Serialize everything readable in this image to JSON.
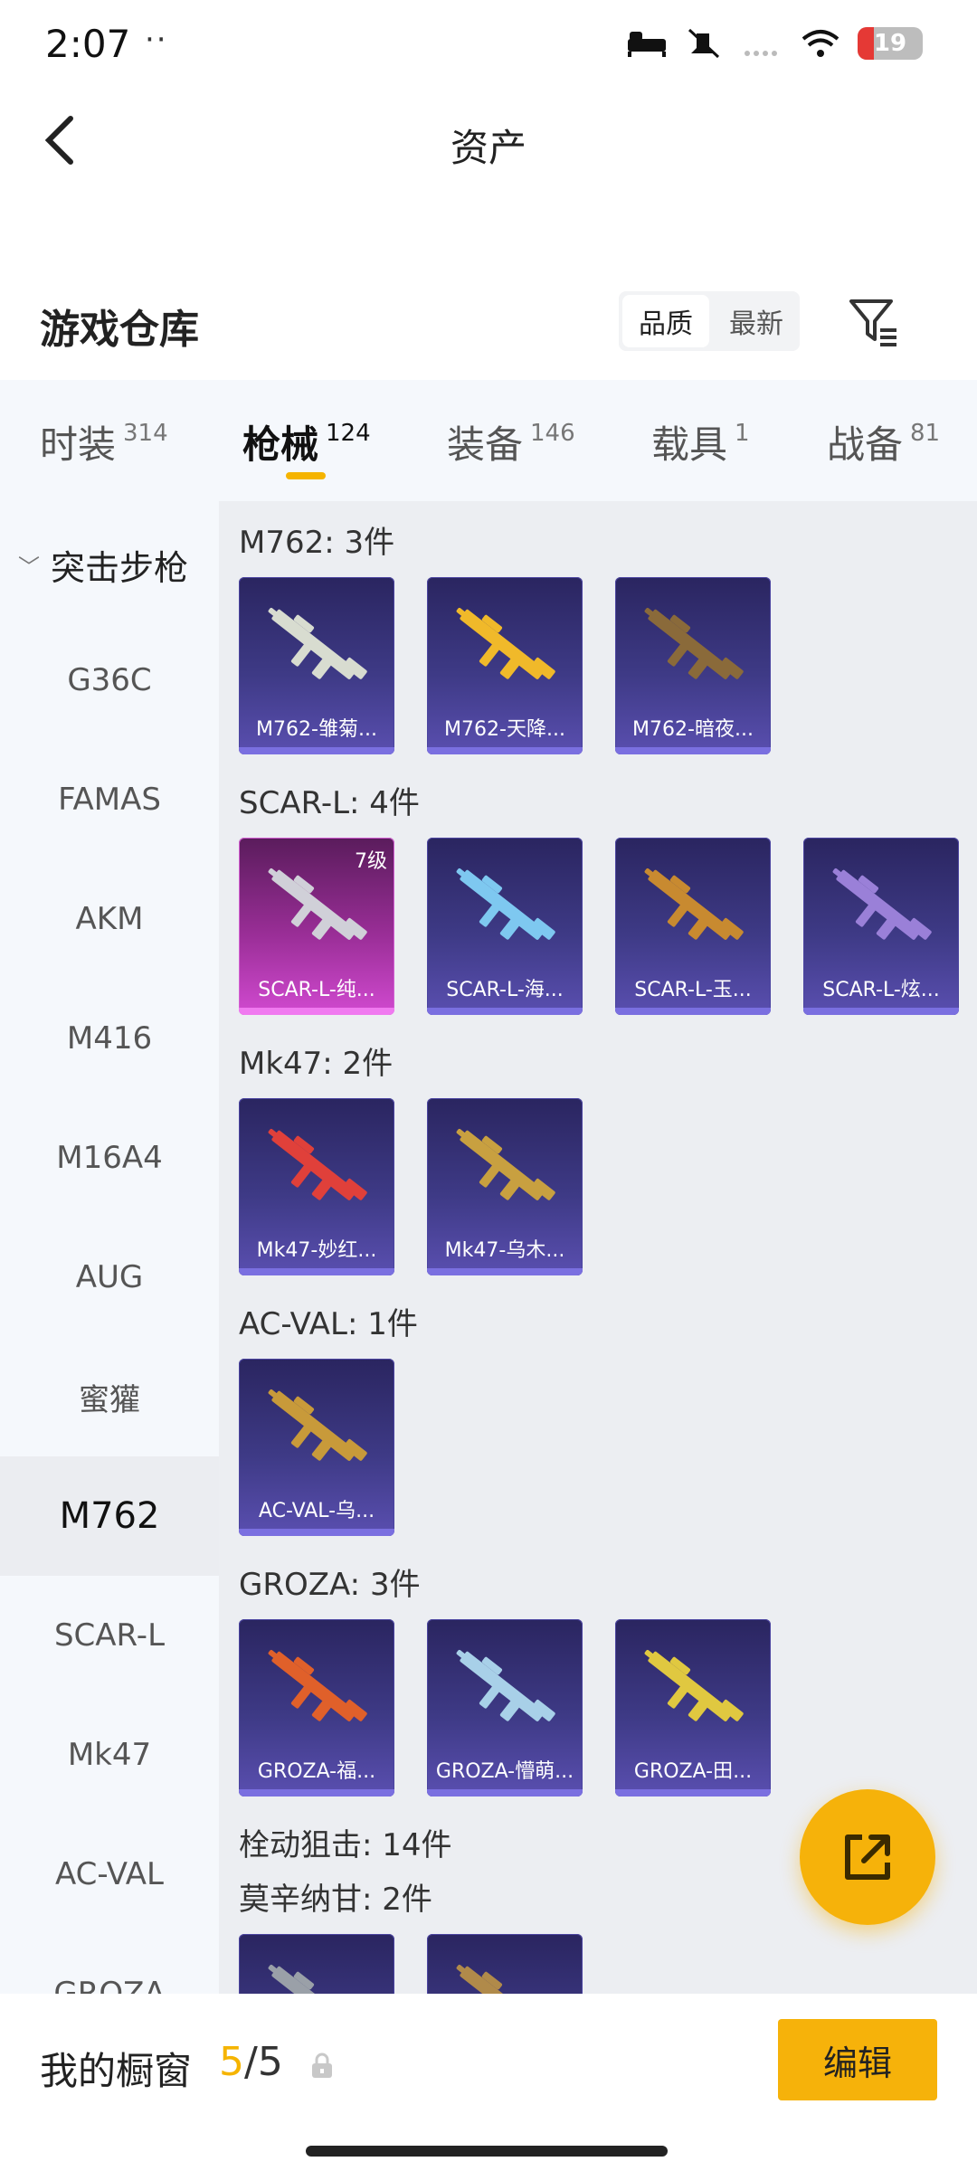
{
  "status": {
    "time": "2:07",
    "dots": "··",
    "battery": "19"
  },
  "header": {
    "title": "资产",
    "back_icon": "chevron-left-icon"
  },
  "section": {
    "title": "游戏仓库",
    "sort": [
      "品质",
      "最新"
    ],
    "filter_icon": "filter-icon"
  },
  "tabs": [
    {
      "label": "时装",
      "count": "314"
    },
    {
      "label": "枪械",
      "count": "124",
      "active": true
    },
    {
      "label": "装备",
      "count": "146"
    },
    {
      "label": "载具",
      "count": "1"
    },
    {
      "label": "战备",
      "count": "81"
    }
  ],
  "sidebar": {
    "heading": "突击步枪",
    "items": [
      "G36C",
      "FAMAS",
      "AKM",
      "M416",
      "M16A4",
      "AUG",
      "蜜獾",
      "M762",
      "SCAR-L",
      "Mk47",
      "AC-VAL",
      "GROZA"
    ],
    "active": "M762"
  },
  "groups": [
    {
      "title": "M762: 3件",
      "items": [
        {
          "label": "M762-雏菊...",
          "color": "#d8dcd0"
        },
        {
          "label": "M762-天降...",
          "color": "#f0b92a"
        },
        {
          "label": "M762-暗夜...",
          "color": "#8a6a3a"
        }
      ]
    },
    {
      "title": "SCAR-L: 4件",
      "items": [
        {
          "label": "SCAR-L-纯...",
          "color": "#d0d0d8",
          "level": "7级",
          "legend": true
        },
        {
          "label": "SCAR-L-海...",
          "color": "#7ec8f0"
        },
        {
          "label": "SCAR-L-玉...",
          "color": "#c88a30"
        },
        {
          "label": "SCAR-L-炫...",
          "color": "#9a80d8"
        }
      ]
    },
    {
      "title": "Mk47: 2件",
      "items": [
        {
          "label": "Mk47-妙红...",
          "color": "#e0403a"
        },
        {
          "label": "Mk47-乌木...",
          "color": "#c8a040"
        }
      ]
    },
    {
      "title": "AC-VAL: 1件",
      "items": [
        {
          "label": "AC-VAL-乌...",
          "color": "#c89a3a"
        }
      ]
    },
    {
      "title": "GROZA: 3件",
      "items": [
        {
          "label": "GROZA-福...",
          "color": "#e0602a"
        },
        {
          "label": "GROZA-懵萌...",
          "color": "#a8d0e8"
        },
        {
          "label": "GROZA-田...",
          "color": "#e0c840"
        }
      ]
    },
    {
      "title": "栓动狙击: 14件",
      "items": []
    },
    {
      "title": "莫辛纳甘: 2件",
      "items": [
        {
          "label": "",
          "color": "#9aa0a8"
        },
        {
          "label": "",
          "color": "#b08a4a"
        }
      ]
    }
  ],
  "fab": {
    "icon": "share-icon"
  },
  "footer": {
    "label": "我的橱窗",
    "current": "5",
    "separator": "/",
    "total": "5",
    "edit": "编辑"
  }
}
